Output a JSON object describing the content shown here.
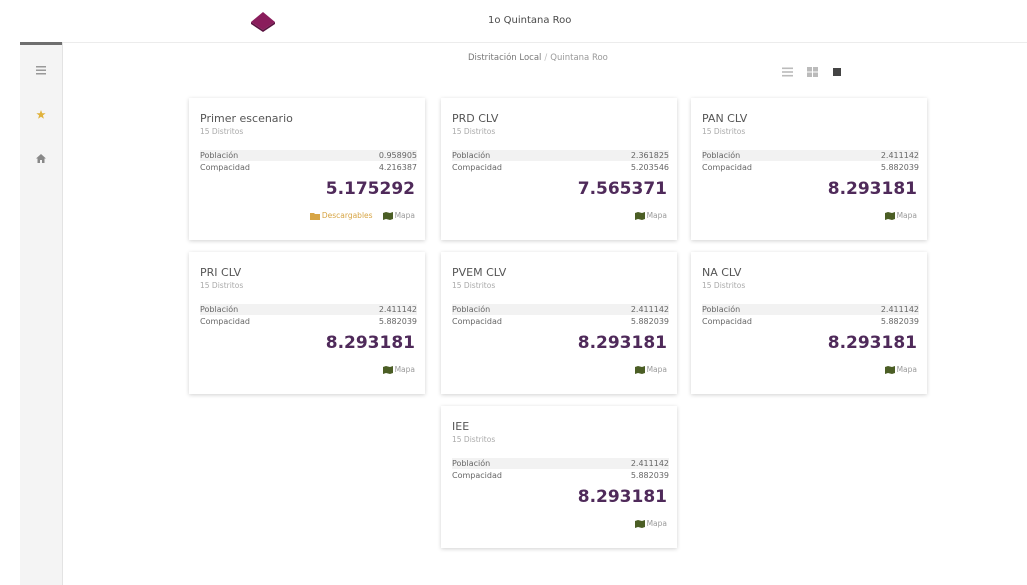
{
  "header": {
    "title": "1o Quintana Roo"
  },
  "breadcrumb": {
    "section": "Distritación Local",
    "separator": "/",
    "current": "Quintana Roo"
  },
  "sidebar": {
    "items": [
      {
        "icon": "menu-icon"
      },
      {
        "icon": "star-icon"
      },
      {
        "icon": "home-icon"
      }
    ]
  },
  "view_toggles": [
    "list-view-icon",
    "grid-view-icon",
    "card-view-icon"
  ],
  "cards": [
    {
      "title": "Primer escenario",
      "subtitle": "15 Distritos",
      "poblacion_label": "Población",
      "poblacion": "0.958905",
      "compacidad_label": "Compacidad",
      "compacidad": "4.216387",
      "score": "5.175292",
      "download_label": "Descargables",
      "map_label": "Mapa"
    },
    {
      "title": "PRD CLV",
      "subtitle": "15 Distritos",
      "poblacion_label": "Población",
      "poblacion": "2.361825",
      "compacidad_label": "Compacidad",
      "compacidad": "5.203546",
      "score": "7.565371",
      "map_label": "Mapa"
    },
    {
      "title": "PAN CLV",
      "subtitle": "15 Distritos",
      "poblacion_label": "Población",
      "poblacion": "2.411142",
      "compacidad_label": "Compacidad",
      "compacidad": "5.882039",
      "score": "8.293181",
      "map_label": "Mapa"
    },
    {
      "title": "PRI CLV",
      "subtitle": "15 Distritos",
      "poblacion_label": "Población",
      "poblacion": "2.411142",
      "compacidad_label": "Compacidad",
      "compacidad": "5.882039",
      "score": "8.293181",
      "map_label": "Mapa"
    },
    {
      "title": "PVEM CLV",
      "subtitle": "15 Distritos",
      "poblacion_label": "Población",
      "poblacion": "2.411142",
      "compacidad_label": "Compacidad",
      "compacidad": "5.882039",
      "score": "8.293181",
      "map_label": "Mapa"
    },
    {
      "title": "NA CLV",
      "subtitle": "15 Distritos",
      "poblacion_label": "Población",
      "poblacion": "2.411142",
      "compacidad_label": "Compacidad",
      "compacidad": "5.882039",
      "score": "8.293181",
      "map_label": "Mapa"
    },
    {
      "title": "IEE",
      "subtitle": "15 Distritos",
      "poblacion_label": "Población",
      "poblacion": "2.411142",
      "compacidad_label": "Compacidad",
      "compacidad": "5.882039",
      "score": "8.293181",
      "map_label": "Mapa"
    }
  ],
  "colors": {
    "brand": "#8a1d5c",
    "score": "#4f2a5a",
    "download": "#d7a545",
    "map_icon": "#4b5e25"
  }
}
